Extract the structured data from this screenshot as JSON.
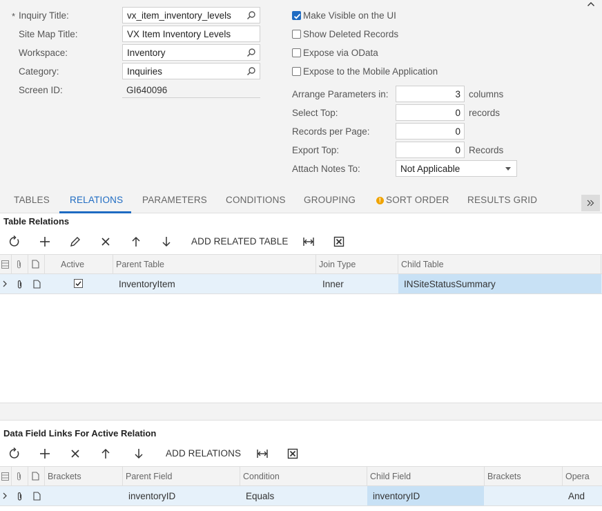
{
  "form": {
    "required_mark": "*",
    "inquiry_title_label": "Inquiry Title:",
    "inquiry_title_value": "vx_item_inventory_levels",
    "site_map_title_label": "Site Map Title:",
    "site_map_title_value": "VX Item Inventory Levels",
    "workspace_label": "Workspace:",
    "workspace_value": "Inventory",
    "category_label": "Category:",
    "category_value": "Inquiries",
    "screen_id_label": "Screen ID:",
    "screen_id_value": "GI640096"
  },
  "options": {
    "make_visible_label": "Make Visible on the UI",
    "make_visible_checked": true,
    "show_deleted_label": "Show Deleted Records",
    "show_deleted_checked": false,
    "expose_odata_label": "Expose via OData",
    "expose_odata_checked": false,
    "expose_mobile_label": "Expose to the Mobile Application",
    "expose_mobile_checked": false,
    "arrange_label": "Arrange Parameters in:",
    "arrange_value": "3",
    "arrange_unit": "columns",
    "select_top_label": "Select Top:",
    "select_top_value": "0",
    "select_top_unit": "records",
    "records_per_page_label": "Records per Page:",
    "records_per_page_value": "0",
    "export_top_label": "Export Top:",
    "export_top_value": "0",
    "export_top_unit": "Records",
    "attach_notes_label": "Attach Notes To:",
    "attach_notes_value": "Not Applicable"
  },
  "tabs": [
    {
      "label": "TABLES"
    },
    {
      "label": "RELATIONS"
    },
    {
      "label": "PARAMETERS"
    },
    {
      "label": "CONDITIONS"
    },
    {
      "label": "GROUPING"
    },
    {
      "label": "SORT ORDER"
    },
    {
      "label": "RESULTS GRID"
    }
  ],
  "active_tab": "RELATIONS",
  "warning_glyph": "!",
  "table_relations": {
    "title": "Table Relations",
    "add_button": "ADD RELATED TABLE",
    "columns": [
      "Active",
      "Parent Table",
      "Join Type",
      "Child Table"
    ],
    "rows": [
      {
        "active": true,
        "parent_table": "InventoryItem",
        "join_type": "Inner",
        "child_table": "INSiteStatusSummary"
      }
    ]
  },
  "field_links": {
    "title": "Data Field Links For Active Relation",
    "add_button": "ADD RELATIONS",
    "columns": [
      "Brackets",
      "Parent Field",
      "Condition",
      "Child Field",
      "Brackets",
      "Opera"
    ],
    "rows": [
      {
        "brackets_open": "",
        "parent_field": "inventoryID",
        "condition": "Equals",
        "child_field": "inventoryID",
        "brackets_close": "",
        "operator": "And"
      }
    ]
  },
  "colors": {
    "accent": "#1e6bc2",
    "header_bg": "#f3f3f3",
    "row_bg": "#e6f1fa",
    "row_selected_bg": "#c8e1f5",
    "warning": "#f0a400"
  }
}
